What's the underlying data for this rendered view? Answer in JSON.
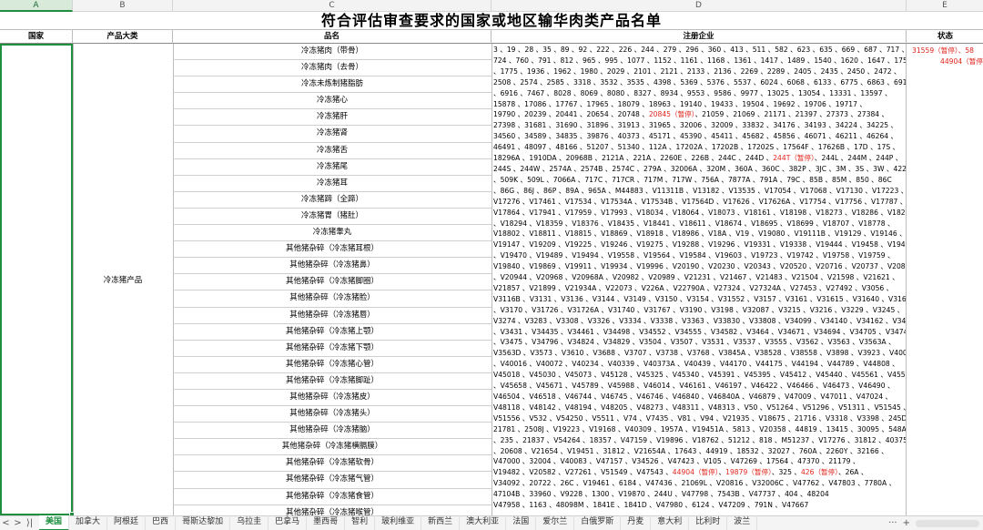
{
  "columns": [
    {
      "letter": "A",
      "selected": true
    },
    {
      "letter": "B",
      "selected": false
    },
    {
      "letter": "C",
      "selected": false
    },
    {
      "letter": "D",
      "selected": false
    },
    {
      "letter": "E",
      "selected": false
    }
  ],
  "title": "符合评估审查要求的国家或地区输华肉类产品名单",
  "headers": {
    "country": "国家",
    "category": "产品大类",
    "product": "品名",
    "company": "注册企业",
    "status": "状态"
  },
  "cells": {
    "country": "",
    "category": "冷冻猪产品"
  },
  "products": [
    "冷冻猪肉（带骨）",
    "冷冻猪肉（去骨）",
    "冷冻未炼制猪脂肪",
    "冷冻猪心",
    "冷冻猪肝",
    "冷冻猪肾",
    "冷冻猪舌",
    "冷冻猪尾",
    "冷冻猪耳",
    "冷冻猪蹄（全蹄）",
    "冷冻猪胃（猪肚）",
    "冷冻猪睾丸",
    "其他猪杂碎（冷冻猪耳根）",
    "其他猪杂碎（冷冻猪鼻）",
    "其他猪杂碎（冷冻猪脚圈）",
    "其他猪杂碎（冷冻猪脸）",
    "其他猪杂碎（冷冻猪唇）",
    "其他猪杂碎（冷冻猪上颚）",
    "其他猪杂碎（冷冻猪下颚）",
    "其他猪杂碎（冷冻猪心管）",
    "其他猪杂碎（冷冻猪脚趾）",
    "其他猪杂碎（冷冻猪皮）",
    "其他猪杂碎（冷冻猪头）",
    "其他猪杂碎（冷冻猪脑）",
    "其他猪杂碎（冷冻猪横膈膜）",
    "其他猪杂碎（冷冻猪软骨）",
    "其他猪杂碎（冷冻猪气管）",
    "其他猪杂碎（冷冻猪食管）",
    "其他猪杂碎（冷冻猪喉管）"
  ],
  "company_lines": [
    [
      {
        "t": "3 、19 、28 、35 、89 、92 、222 、226 、244 、279 、296 、360 、413 、511 、582 、623 、635 、669 、687 、717 、"
      }
    ],
    [
      {
        "t": "724 、760 、791 、812 、965 、995 、1077 、1152 、1161 、1168 、1361 、1417 、1489 、1540 、1620 、1647 、1758"
      }
    ],
    [
      {
        "t": "、1775 、1936 、1962 、1980 、2029 、2101 、2121 、2133 、2136 、2269 、2289 、2405 、2435 、2450 、2472 、"
      }
    ],
    [
      {
        "t": "2508 、2574 、2585 、3318 、3532 、3535 、4398 、5369 、5376 、5537 、6024 、6068 、6133 、6775 、6863 、6911"
      }
    ],
    [
      {
        "t": "、6916 、7467 、8028 、8069 、8080 、8327 、8934 、9553 、9586 、9977 、13025 、13054 、13331 、13597 、"
      }
    ],
    [
      {
        "t": "15878 、17086 、17767 、17965 、18079 、18963 、19140 、19433 、19504 、19692 、19706 、19717 、"
      }
    ],
    [
      {
        "t": "19790 、20239 、20441 、20654 、20748 、"
      },
      {
        "t": "20845（暂停）",
        "red": true
      },
      {
        "t": "、21059 、21069 、21171 、21397 、27373 、27384 、"
      }
    ],
    [
      {
        "t": "27398 、31681 、31690 、31896 、31913 、31965 、32006 、32009 、33832 、34176 、34193 、34224 、34225 、"
      }
    ],
    [
      {
        "t": "34560 、34589 、34835 、39876 、40373 、45171 、45390 、45411 、45682 、45856 、46071 、46211 、46264 、"
      }
    ],
    [
      {
        "t": "46491 、48097 、48166 、51207 、51340 、112A 、17202A 、17202B 、17202S 、17564F 、17626B 、17D 、17S 、"
      }
    ],
    [
      {
        "t": "18296A 、1910DA 、20968B 、2121A 、221A 、2260E 、226B 、244C 、244D 、"
      },
      {
        "t": "244T（暂停）",
        "red": true
      },
      {
        "t": "、244L 、244M 、244P 、"
      }
    ],
    [
      {
        "t": "244S 、244W 、2574A 、2574B 、2574C 、279A 、32006A 、320M 、360A 、360C 、382P 、3JC 、3M 、3S 、3W 、4226B"
      }
    ],
    [
      {
        "t": "、509K 、509L 、7066A 、717C 、717CR 、717M 、717W 、756A 、7877A 、791A 、79C 、85B 、85M 、850 、86C"
      }
    ],
    [
      {
        "t": "、86G 、86J 、86P 、89A 、965A 、M44883 、V11311B 、V13182 、V13535 、V17054 、V17068 、V17130 、V17223 、"
      }
    ],
    [
      {
        "t": "V17276 、V17461 、V17534 、V17534A 、V17534B 、V17564D 、V17626 、V17626A 、V17754 、V17756 、V17787 、"
      }
    ],
    [
      {
        "t": "V17864 、V17941 、V17959 、V17993 、V18034 、V18064 、V18073 、V18161 、V18198 、V18273 、V18286 、V18290"
      }
    ],
    [
      {
        "t": "、V18294 、V18359 、V18376 、V18435 、V18441 、V18611 、V18674 、V18695 、V18699 、V18707 、V18778 、"
      }
    ],
    [
      {
        "t": "V18802 、V18811 、V18815 、V18869 、V18918 、V18986 、V18A 、V19 、V19080 、V19111B 、V19129 、V19146 、"
      }
    ],
    [
      {
        "t": "V19147 、V19209 、V19225 、V19246 、V19275 、V19288 、V19296 、V19331 、V19338 、V19444 、V19458 、V19464"
      }
    ],
    [
      {
        "t": "、V19470 、V19489 、V19494 、V19558 、V19564 、V19584 、V19603 、V19723 、V19742 、V19758 、V19759 、"
      }
    ],
    [
      {
        "t": "V19840 、V19869 、V19911 、V19934 、V19996 、V20190 、V20230 、V20343 、V20520 、V20716 、V20737 、V20886"
      }
    ],
    [
      {
        "t": "、V20944 、V20968 、V20968A 、V20982 、V20989 、V21231 、V21467 、V21483 、V21504 、V21598 、V21621 、"
      }
    ],
    [
      {
        "t": "V21857 、V21899 、V21934A 、V22073 、V226A 、V22790A 、V27324 、V27324A 、V27453 、V27492 、V3056 、"
      }
    ],
    [
      {
        "t": "V3116B 、V3131 、V3136 、V3144 、V3149 、V3150 、V3154 、V31552 、V3157 、V3161 、V31615 、V31640 、V31695"
      }
    ],
    [
      {
        "t": "、V3170 、V31726 、V31726A 、V31740 、V31767 、V3190 、V3198 、V32087 、V3215 、V3216 、V3229 、V3245 、"
      }
    ],
    [
      {
        "t": "V3274 、V3283 、V3308 、V3326 、V3334 、V3338 、V3363 、V33830 、V33808 、V34099 、V34140 、V34162 、V3425"
      }
    ],
    [
      {
        "t": "、V3431 、V34435 、V34461 、V34498 、V34552 、V34555 、V34582 、V3464 、V34671 、V34694 、V34705 、V3474"
      }
    ],
    [
      {
        "t": "、V3475 、V34796 、V34824 、V34829 、V3504 、V3507 、V3531 、V3537 、V3555 、V3562 、V3563 、V3563A 、"
      }
    ],
    [
      {
        "t": "V3563D 、V3573 、V3610 、V3688 、V3707 、V3738 、V3768 、V3845A 、V38528 、V38558 、V3898 、V3923 、V40008"
      }
    ],
    [
      {
        "t": "、V40016 、V40072 、V40234 、V40339 、V40373A 、V40439 、V44170 、V44175 、V44194 、V44789 、V44808 、"
      }
    ],
    [
      {
        "t": "V45018 、V45030 、V45073 、V45128 、V45325 、V45340 、V45391 、V45395 、V45412 、V45440 、V45561 、V45586 、V45656"
      }
    ],
    [
      {
        "t": "、V45658 、V45671 、V45789 、V45988 、V46014 、V46161 、V46197 、V46422 、V46466 、V46473 、V46490 、"
      }
    ],
    [
      {
        "t": "V46504 、V46518 、V46744 、V46745 、V46746 、V46840 、V46840A 、V46879 、V47009 、V47011 、V47024 、"
      }
    ],
    [
      {
        "t": "V48118 、V48142 、V48194 、V48205 、V48273 、V48311 、V48313 、V50 、V51264 、V51296 、V51311 、V51545 、"
      }
    ],
    [
      {
        "t": "V51556 、V532 、V54250 、V5511 、V74 、V7435 、V81 、V94 、V21935 、V18675 、21716 、V3318 、V3398 、245D 、"
      }
    ],
    [
      {
        "t": "21781 、2508J 、V19223 、V19168 、V40309 、1957A 、V19451A 、5813 、V20358 、44819 、13415 、30095 、548A"
      }
    ],
    [
      {
        "t": "、235 、21837 、V54264 、18357 、V47159 、V19896 、V18762 、51212 、818 、M51237 、V17276 、31812 、40375A"
      }
    ],
    [
      {
        "t": "、20608 、V21654 、V19451 、31812 、V21654A 、17643 、44919 、18532 、32027 、760A 、2260Y 、32166 、"
      }
    ],
    [
      {
        "t": "V47000 、32004 、V40083 、V47157 、V34526 、V47423 、V105 、V47269 、17564 、47370 、21179 、"
      }
    ],
    [
      {
        "t": "V19482 、V20582 、V27261 、V51549 、V47543 、"
      },
      {
        "t": "44904（暂停）",
        "red": true
      },
      {
        "t": "、"
      },
      {
        "t": "19879（暂停）",
        "red": true
      },
      {
        "t": "、325 、"
      },
      {
        "t": "426（暂停）",
        "red": true
      },
      {
        "t": "、26A 、"
      }
    ],
    [
      {
        "t": "V34092 、20722 、26C 、V19461 、6184 、V47436 、21069L 、V20816 、V32006C 、V47762 、V47803 、7780A 、"
      }
    ],
    [
      {
        "t": "47104B 、33960 、V9228 、1300 、V19870 、244U 、V47798 、7543B 、V47737 、404 、48204"
      }
    ],
    [
      {
        "t": "V47958 、1163 、48098M 、1841E 、1841D 、V47980 、6124 、V47209 、791N 、V47667"
      }
    ]
  ],
  "status_lines": [
    "31559（暂停）、58",
    "44904（暂停"
  ],
  "tab_nav": [
    "<",
    ">",
    "⟩|"
  ],
  "sheets": [
    {
      "name": "美国",
      "active": true
    },
    {
      "name": "加拿大",
      "active": false
    },
    {
      "name": "阿根廷",
      "active": false
    },
    {
      "name": "巴西",
      "active": false
    },
    {
      "name": "哥斯达黎加",
      "active": false
    },
    {
      "name": "乌拉圭",
      "active": false
    },
    {
      "name": "巴拿马",
      "active": false
    },
    {
      "name": "墨西哥",
      "active": false
    },
    {
      "name": "智利",
      "active": false
    },
    {
      "name": "玻利维亚",
      "active": false
    },
    {
      "name": "新西兰",
      "active": false
    },
    {
      "name": "澳大利亚",
      "active": false
    },
    {
      "name": "法国",
      "active": false
    },
    {
      "name": "爱尔兰",
      "active": false
    },
    {
      "name": "白俄罗斯",
      "active": false
    },
    {
      "name": "丹麦",
      "active": false
    },
    {
      "name": "意大利",
      "active": false
    },
    {
      "name": "比利时",
      "active": false
    },
    {
      "name": "波兰",
      "active": false
    }
  ],
  "tab_tools": {
    "more": "···",
    "add": "+"
  }
}
